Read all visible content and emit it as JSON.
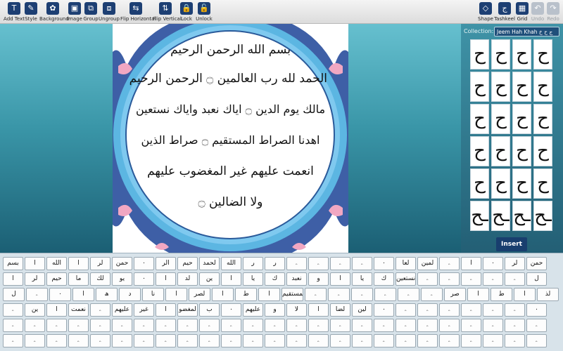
{
  "toolbar": {
    "left": [
      {
        "label": "Add Text",
        "icon": "T",
        "icon_name": "add-text-icon"
      },
      {
        "label": "Style",
        "icon": "✎",
        "icon_name": "style-icon"
      },
      {
        "label": "Background",
        "icon": "✿",
        "icon_name": "background-icon"
      },
      {
        "label": "Image",
        "icon": "▣",
        "icon_name": "image-icon"
      },
      {
        "label": "Group",
        "icon": "⧉",
        "icon_name": "group-icon"
      },
      {
        "label": "Ungroup",
        "icon": "⧈",
        "icon_name": "ungroup-icon"
      },
      {
        "label": "Flip Horizontal",
        "icon": "⇆",
        "icon_name": "flip-horizontal-icon"
      },
      {
        "label": "Flip Vertical",
        "icon": "⇅",
        "icon_name": "flip-vertical-icon"
      },
      {
        "label": "Lock",
        "icon": "🔒",
        "icon_name": "lock-icon"
      },
      {
        "label": "Unlock",
        "icon": "🔓",
        "icon_name": "unlock-icon"
      }
    ],
    "right": [
      {
        "label": "Shape",
        "icon": "◇",
        "icon_name": "shape-icon",
        "disabled": false
      },
      {
        "label": "Tashkeel",
        "icon": "ج",
        "icon_name": "tashkeel-icon",
        "disabled": false
      },
      {
        "label": "Grid",
        "icon": "▦",
        "icon_name": "grid-icon",
        "disabled": false
      },
      {
        "label": "Undo",
        "icon": "↶",
        "icon_name": "undo-icon",
        "disabled": true
      },
      {
        "label": "Redo",
        "icon": "↷",
        "icon_name": "redo-icon",
        "disabled": true
      }
    ]
  },
  "artwork": {
    "lines": [
      "بسم الله الرحمن الرحيم",
      "الحمد لله رب العالمين ۝ الرحمن الرحيم",
      "مالك يوم الدين ۝ اياك نعبد واياك نستعين",
      "اهدنا الصراط المستقيم ۝ صراط الذين",
      "انعمت عليهم غير المغضوب عليهم",
      "ولا الضالين ۝"
    ]
  },
  "collection": {
    "label": "Collection:",
    "selected": "Jeem Hah Khah ج ح خ",
    "glyphs": [
      "ح",
      "ح",
      "ح",
      "ح",
      "ح",
      "ح",
      "ح",
      "ح",
      "ح",
      "ح",
      "ح",
      "ح",
      "ح",
      "ح",
      "ح",
      "ح",
      "ح",
      "ح",
      "ح",
      "ح",
      "ـح",
      "ـح",
      "ـح",
      "ـح"
    ],
    "insert_label": "Insert"
  },
  "keyboard": {
    "rows": [
      [
        "بسم",
        "ا",
        "الله",
        "ا",
        "لر",
        "حمن",
        "۰",
        "الر",
        "حيم",
        "لحمد",
        "الله",
        "ر",
        "ر",
        "ۦ",
        "ۦ",
        "ۦ",
        "ۦ",
        "۰",
        "لعا",
        "لمين",
        "ۦ",
        "ا",
        "۰",
        "لر",
        "حمن"
      ],
      [
        "ا",
        "لر",
        "حيم",
        "ما",
        "لك",
        "يو",
        "۰",
        "ا",
        "لد",
        "ين",
        "ا",
        "يا",
        "ك",
        "نعبد",
        "و",
        "ا",
        "يا",
        "ك",
        "نستعين",
        "ۦ",
        "ۦ",
        "ۦ",
        "ۦ",
        "ۦ",
        "ل"
      ],
      [
        "ل",
        "ۦ",
        "۰",
        "ا",
        "ھ",
        "د",
        "نا",
        "ا",
        "لصر",
        "ا",
        "ط",
        "ا",
        "لمستقيم",
        "ۦ",
        "ۦ",
        "ۦ",
        "ۦ",
        "ۦ",
        "ۦ",
        "صر",
        "ا",
        "ط",
        "ا",
        "لذ"
      ],
      [
        "ۦ",
        "ين",
        "ا",
        "نعمت",
        "ۦ",
        "عليهم",
        "غير",
        "ا",
        "لمغضو",
        "ب",
        "۰",
        "عليهم",
        "و",
        "لا",
        "ا",
        "لضا",
        "لين",
        "۰",
        "ۦ",
        "ۦ",
        "ۦ",
        "ۦ",
        "ۦ",
        "ۦ",
        "۰"
      ],
      [
        "ۦ",
        "ۦ",
        "ۦ",
        "ۦ",
        "ۦ",
        "ۦ",
        "ۦ",
        "ۦ",
        "ۦ",
        "ۦ",
        "ۦ",
        "ۦ",
        "ۦ",
        "ۦ",
        "ۦ",
        "ۦ",
        "ۦ",
        "ۦ",
        "ۦ",
        "ۦ",
        "ۦ",
        "ۦ",
        "ۦ",
        "ۦ",
        "ۦ"
      ],
      [
        "ۦ",
        "ۦ",
        "ۦ",
        "ۦ",
        "ۦ",
        "ۦ",
        "ۦ",
        "ۦ",
        "ۦ",
        "ۦ",
        "ۦ",
        "ۦ",
        "ۦ",
        "ۦ",
        "ۦ",
        "ۦ",
        "ۦ",
        "ۦ",
        "ۦ",
        "ۦ",
        "ۦ",
        "ۦ",
        "ۦ",
        "ۦ",
        "ۦ"
      ]
    ]
  }
}
